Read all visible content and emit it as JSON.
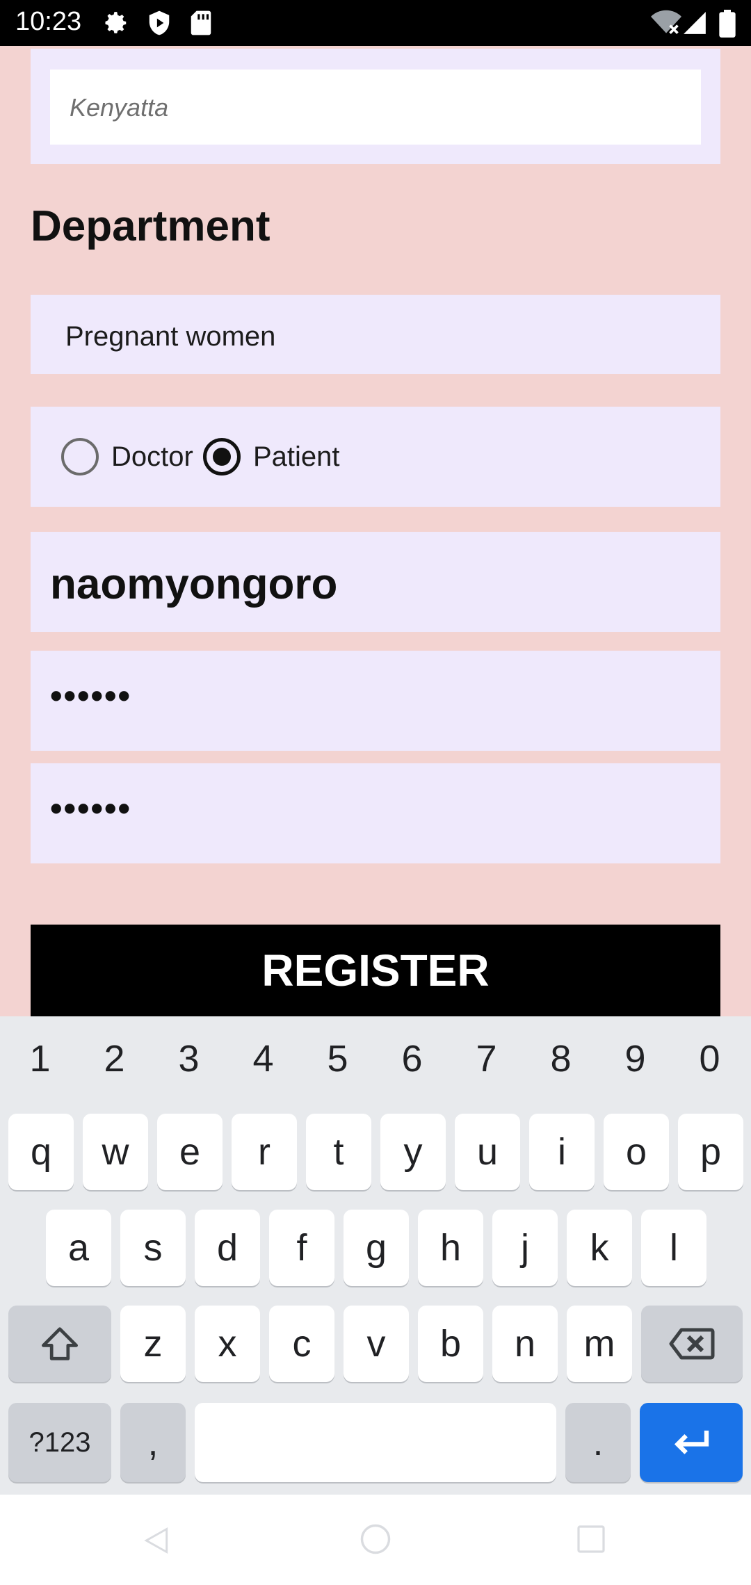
{
  "status_bar": {
    "time": "10:23",
    "icons": [
      "gear-icon",
      "play-protect-icon",
      "sd-card-icon",
      "wifi-off-icon",
      "signal-icon",
      "battery-icon"
    ]
  },
  "form": {
    "hospital_value": "Kenyatta",
    "department_title": "Department",
    "department_value": "Pregnant women",
    "role_options": [
      {
        "label": "Doctor",
        "selected": false
      },
      {
        "label": "Patient",
        "selected": true
      }
    ],
    "username_value": "naomyongoro",
    "password_value": "••••••",
    "confirm_password_value": "••••••",
    "register_label": "REGISTER"
  },
  "keyboard": {
    "number_row": [
      "1",
      "2",
      "3",
      "4",
      "5",
      "6",
      "7",
      "8",
      "9",
      "0"
    ],
    "row1": [
      "q",
      "w",
      "e",
      "r",
      "t",
      "y",
      "u",
      "i",
      "o",
      "p"
    ],
    "row2": [
      "a",
      "s",
      "d",
      "f",
      "g",
      "h",
      "j",
      "k",
      "l"
    ],
    "row3": [
      "z",
      "x",
      "c",
      "v",
      "b",
      "n",
      "m"
    ],
    "symbols_label": "?123",
    "comma_label": ",",
    "period_label": ".",
    "accent_color": "#1a73e8"
  }
}
